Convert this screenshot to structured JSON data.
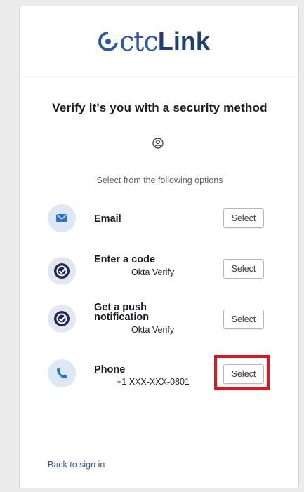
{
  "logo": {
    "text_ctc": "ctc",
    "text_link": "Link"
  },
  "title": "Verify it's you with a security method",
  "subtitle": "Select from the following options",
  "methods": [
    {
      "label": "Email",
      "sublabel": "",
      "button": "Select",
      "icon": "email-icon"
    },
    {
      "label": "Enter a code",
      "sublabel": "Okta Verify",
      "button": "Select",
      "icon": "okta-verify-icon"
    },
    {
      "label": "Get a push notification",
      "sublabel": "Okta Verify",
      "button": "Select",
      "icon": "okta-verify-icon"
    },
    {
      "label": "Phone",
      "sublabel": "+1 XXX-XXX-0801",
      "button": "Select",
      "icon": "phone-icon"
    }
  ],
  "back_link": "Back to sign in",
  "colors": {
    "brand_blue": "#2a5aa8",
    "brand_dark": "#1f3f7a",
    "icon_bg": "#dce8f6",
    "highlight": "#e0151f"
  }
}
